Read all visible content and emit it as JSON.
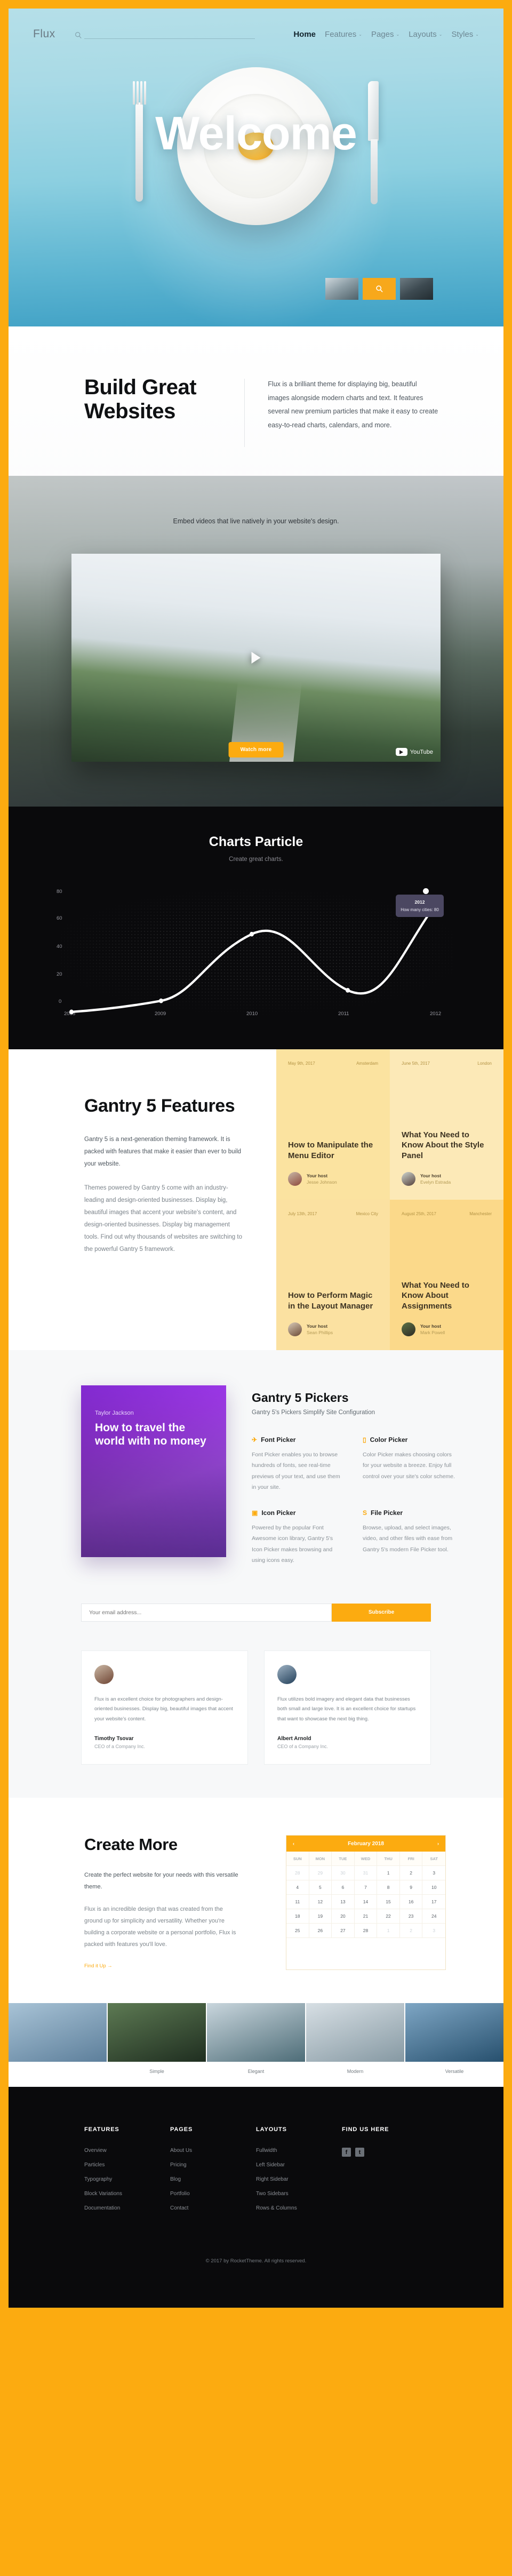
{
  "header": {
    "brand": "Flux",
    "search_placeholder": "",
    "nav": [
      {
        "label": "Home",
        "caret": "",
        "active": true
      },
      {
        "label": "Features",
        "caret": "⌄",
        "active": false
      },
      {
        "label": "Pages",
        "caret": "⌄",
        "active": false
      },
      {
        "label": "Layouts",
        "caret": "⌄",
        "active": false
      },
      {
        "label": "Styles",
        "caret": "⌄",
        "active": false
      }
    ]
  },
  "hero": {
    "title": "Welcome",
    "thumbs": [
      "image-thumb-1",
      "search-thumb",
      "image-thumb-3"
    ]
  },
  "build": {
    "title": "Build Great Websites",
    "body": "Flux is a brilliant theme for displaying big, beautiful images alongside modern charts and text. It features several new premium particles that make it easy to create easy-to-read charts, calendars, and more."
  },
  "video": {
    "caption": "Embed videos that live natively in your website's design.",
    "youtube_label": "YouTube",
    "watch_more": "Watch more"
  },
  "charts": {
    "title": "Charts Particle",
    "subtitle": "Create great charts.",
    "tooltip_year": "2012",
    "tooltip_value": "How many cities: 80"
  },
  "chart_data": {
    "type": "line",
    "title": "Charts Particle",
    "subtitle": "Create great charts.",
    "x": [
      "2008",
      "2009",
      "2010",
      "2011",
      "2012"
    ],
    "series": [
      {
        "name": "How many cities",
        "values": [
          1,
          6,
          48,
          11,
          80
        ]
      }
    ],
    "xlabel": "",
    "ylabel": "",
    "ylim": [
      0,
      88
    ],
    "yticks": [
      0,
      20,
      40,
      60,
      80
    ],
    "grid": false,
    "legend": "none",
    "annotations": [
      {
        "x": "2012",
        "y": 80,
        "text": "2012 — How many cities: 80"
      }
    ]
  },
  "g5": {
    "title": "Gantry 5 Features",
    "para1": "Gantry 5 is a next-generation theming framework. It is packed with features that make it easier than ever to build your website.",
    "para2": "Themes powered by Gantry 5 come with an industry-leading and design-oriented businesses. Display big, beautiful images that accent your website's content, and design-oriented businesses. Display big management tools. Find out why thousands of websites are switching to the powerful Gantry 5 framework.",
    "cards": [
      {
        "date": "May 9th, 2017",
        "city": "Amsterdam",
        "title": "How to Manipulate the Menu Editor",
        "host_label": "Your host",
        "host_name": "Jesse Johnson"
      },
      {
        "date": "June 5th, 2017",
        "city": "London",
        "title": "What You Need to Know About the Style Panel",
        "host_label": "Your host",
        "host_name": "Evelyn Estrada"
      },
      {
        "date": "July 13th, 2017",
        "city": "Mexico City",
        "title": "How to Perform Magic in the Layout Manager",
        "host_label": "Your host",
        "host_name": "Sean Phillips"
      },
      {
        "date": "August 25th, 2017",
        "city": "Manchester",
        "title": "What You Need to Know About Assignments",
        "host_label": "Your host",
        "host_name": "Mark Powell"
      }
    ]
  },
  "pickers": {
    "promo_author": "Taylor Jackson",
    "promo_title": "How to travel the world with no money",
    "title": "Gantry 5 Pickers",
    "subtitle": "Gantry 5's Pickers Simplify Site Configuration",
    "items": [
      {
        "icon": "plane-icon",
        "glyph": "✈",
        "title": "Font Picker",
        "body": "Font Picker enables you to browse hundreds of fonts, see real-time previews of your text, and use them in your site."
      },
      {
        "icon": "palette-icon",
        "glyph": "▯",
        "title": "Color Picker",
        "body": "Color Picker makes choosing colors for your website a breeze. Enjoy full control over your site's color scheme."
      },
      {
        "icon": "image-icon",
        "glyph": "▣",
        "title": "Icon Picker",
        "body": "Powered by the popular Font Awesome icon library, Gantry 5's Icon Picker makes browsing and using icons easy."
      },
      {
        "icon": "file-icon",
        "glyph": "S",
        "title": "File Picker",
        "body": "Browse, upload, and select images, video, and other files with ease from Gantry 5's modern File Picker tool."
      }
    ]
  },
  "subscribe": {
    "placeholder": "Your email address...",
    "button": "Subscribe"
  },
  "testimonials": [
    {
      "avatar": "avatar-timothy",
      "quote": "Flux is an excellent choice for photographers and design-oriented businesses. Display big, beautiful images that accent your website's content.",
      "name": "Timothy Tsovar",
      "role": "CEO of a Company Inc."
    },
    {
      "avatar": "avatar-albert",
      "quote": "Flux utilizes bold imagery and elegant data that businesses both small and large love. It is an excellent choice for startups that want to showcase the next big thing.",
      "name": "Albert Arnold",
      "role": "CEO of a Company Inc."
    }
  ],
  "create": {
    "title": "Create More",
    "para1": "Create the perfect website for your needs with this versatile theme.",
    "para2": "Flux is an incredible design that was created from the ground up for simplicity and versatility. Whether you're building a corporate website or a personal portfolio, Flux is packed with features you'll love.",
    "link": "Find it Up →"
  },
  "calendar": {
    "month": "February 2018",
    "prev": "‹",
    "next": "›",
    "dow": [
      "SUN",
      "MON",
      "TUE",
      "WED",
      "THU",
      "FRI",
      "SAT"
    ],
    "weeks": [
      [
        {
          "d": "28",
          "out": true
        },
        {
          "d": "29",
          "out": true
        },
        {
          "d": "30",
          "out": true
        },
        {
          "d": "31",
          "out": true
        },
        {
          "d": "1",
          "out": false
        },
        {
          "d": "2",
          "out": false
        },
        {
          "d": "3",
          "out": false
        }
      ],
      [
        {
          "d": "4",
          "out": false
        },
        {
          "d": "5",
          "out": false
        },
        {
          "d": "6",
          "out": false
        },
        {
          "d": "7",
          "out": false
        },
        {
          "d": "8",
          "out": false
        },
        {
          "d": "9",
          "out": false
        },
        {
          "d": "10",
          "out": false
        }
      ],
      [
        {
          "d": "11",
          "out": false
        },
        {
          "d": "12",
          "out": false
        },
        {
          "d": "13",
          "out": false
        },
        {
          "d": "14",
          "out": false
        },
        {
          "d": "15",
          "out": false
        },
        {
          "d": "16",
          "out": false
        },
        {
          "d": "17",
          "out": false
        }
      ],
      [
        {
          "d": "18",
          "out": false
        },
        {
          "d": "19",
          "out": false
        },
        {
          "d": "20",
          "out": false
        },
        {
          "d": "21",
          "out": false
        },
        {
          "d": "22",
          "out": false
        },
        {
          "d": "23",
          "out": false
        },
        {
          "d": "24",
          "out": false
        }
      ],
      [
        {
          "d": "25",
          "out": false
        },
        {
          "d": "26",
          "out": false
        },
        {
          "d": "27",
          "out": false
        },
        {
          "d": "28",
          "out": false
        },
        {
          "d": "1",
          "out": true
        },
        {
          "d": "2",
          "out": true
        },
        {
          "d": "3",
          "out": true
        }
      ]
    ]
  },
  "gallery": [
    {
      "caption": ""
    },
    {
      "caption": "Simple"
    },
    {
      "caption": "Elegant"
    },
    {
      "caption": "Modern"
    },
    {
      "caption": "Versatile"
    }
  ],
  "footer": {
    "columns": [
      {
        "title": "FEATURES",
        "links": [
          "Overview",
          "Particles",
          "Typography",
          "Block Variations",
          "Documentation"
        ]
      },
      {
        "title": "PAGES",
        "links": [
          "About Us",
          "Pricing",
          "Blog",
          "Portfolio",
          "Contact"
        ]
      },
      {
        "title": "LAYOUTS",
        "links": [
          "Fullwidth",
          "Left Sidebar",
          "Right Sidebar",
          "Two Sidebars",
          "Rows & Columns"
        ]
      }
    ],
    "social_title": "FIND US HERE",
    "socials": [
      {
        "name": "facebook-icon",
        "glyph": "f"
      },
      {
        "name": "twitter-icon",
        "glyph": "t"
      }
    ],
    "copyright": "© 2017 by RocketTheme. All rights reserved."
  },
  "colors": {
    "accent": "#fcab10",
    "dark": "#0a0a0c",
    "card_yellow": "#fbe3a0"
  }
}
